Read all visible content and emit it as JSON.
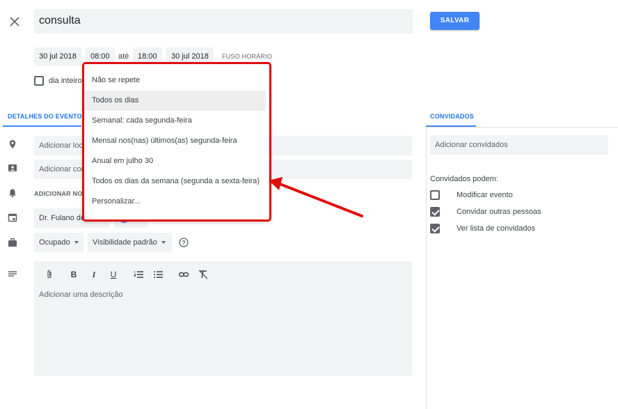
{
  "header": {
    "title_value": "consulta",
    "save_label": "SALVAR"
  },
  "datetime": {
    "start_date": "30 jul 2018",
    "start_time": "08:00",
    "separator": "até",
    "end_time": "18:00",
    "end_date": "30 jul 2018",
    "timezone_label": "FUSO HORÁRIO",
    "all_day_label": "dia inteiro",
    "all_day_checked": false
  },
  "tabs": {
    "details_label": "DETALHES DO EVENTO",
    "guests_label": "CONVIDADOS"
  },
  "details": {
    "location_placeholder": "Adicionar loca",
    "conference_placeholder": "Adicionar con",
    "notification_label": "ADICIONAR NOTIF",
    "calendar_value": "Dr. Fulano de Tal",
    "color_swatch": "#7986cb",
    "status_value": "Ocupado",
    "visibility_value": "Visibilidade padrão",
    "description_placeholder": "Adicionar uma descrição"
  },
  "toolbar": {
    "items": [
      "attach-icon",
      "bold-icon",
      "italic-icon",
      "underline-icon",
      "numbered-list-icon",
      "bulleted-list-icon",
      "link-icon",
      "clear-format-icon"
    ],
    "bold": "B",
    "italic": "I",
    "underline": "U"
  },
  "guests": {
    "input_placeholder": "Adicionar convidados",
    "permissions_title": "Convidados podem:",
    "permissions": [
      {
        "label": "Modificar evento",
        "checked": false
      },
      {
        "label": "Convidar outras pessoas",
        "checked": true
      },
      {
        "label": "Ver lista de convidados",
        "checked": true
      }
    ]
  },
  "repeat_menu": {
    "options": [
      "Não se repete",
      "Todos os dias",
      "Semanal: cada segunda-feira",
      "Mensal nos(nas) últimos(as) segunda-feira",
      "Anual em julho 30",
      "Todos os dias da semana (segunda a sexta-feira)",
      "Personalizar..."
    ],
    "highlighted_index": 1
  },
  "colors": {
    "accent": "#4285f4",
    "annotation_red": "#e00d0d",
    "field_bg": "#f1f3f4"
  }
}
